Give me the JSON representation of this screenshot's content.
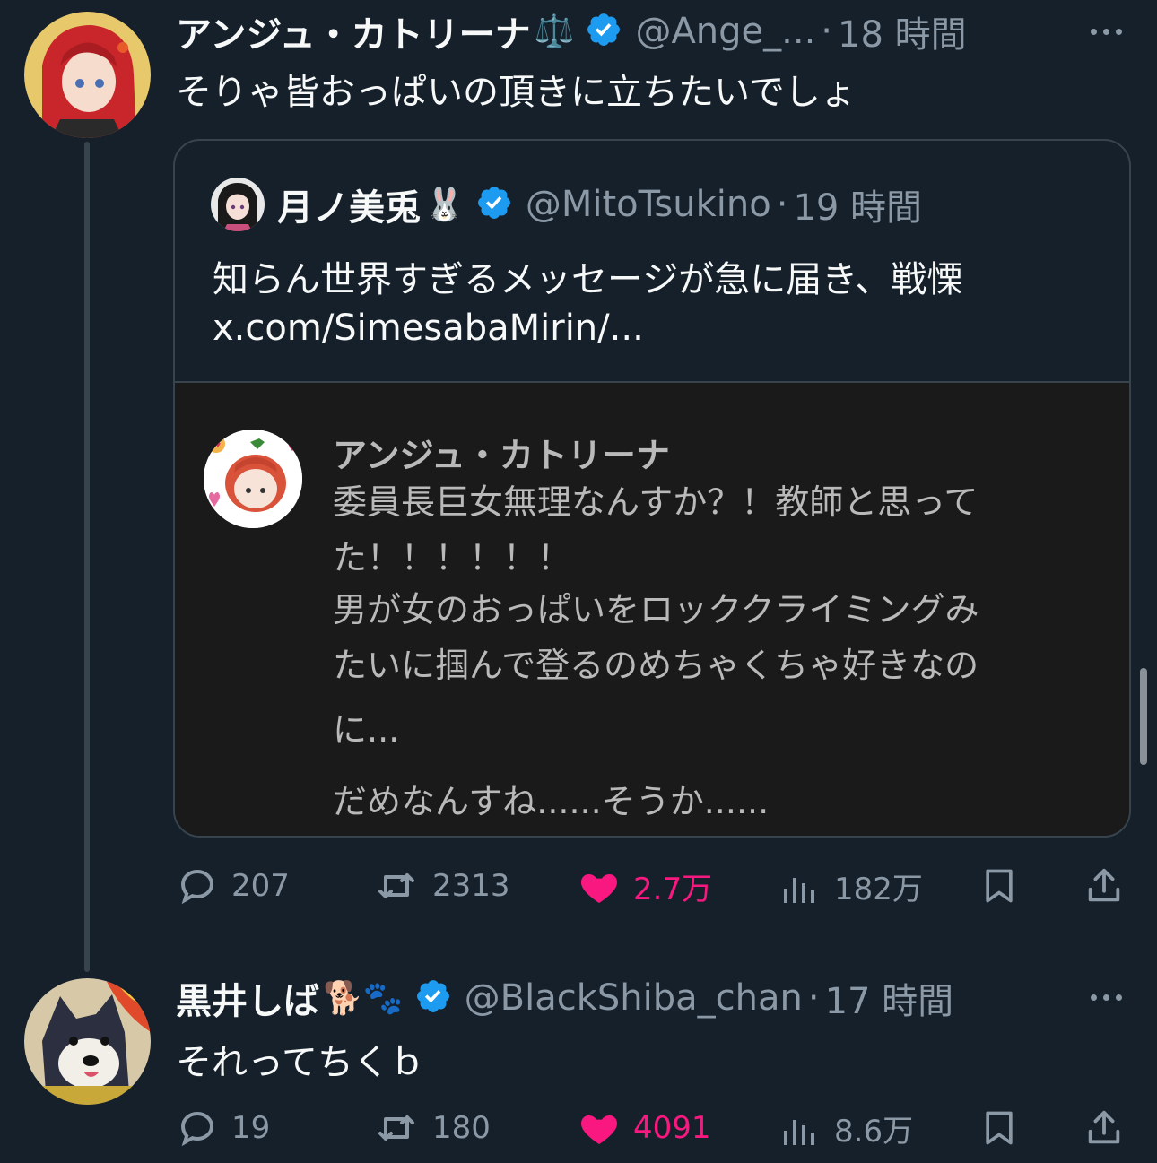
{
  "tweet1": {
    "display_name": "アンジュ・カトリーナ",
    "name_emoji": "⚖️",
    "handle": "@Ange_...",
    "time": "18 時間",
    "text": "そりゃ皆おっぱいの頂きに立ちたいでしょ",
    "quote": {
      "display_name": "月ノ美兎",
      "name_emoji": "🐰",
      "handle": "@MitoTsukino",
      "time": "19 時間",
      "text_line1": "知らん世界すぎるメッセージが急に届き、戦慄",
      "text_line2": "x.com/SimesabaMirin/...",
      "media": {
        "name": "アンジュ・カトリーナ",
        "lines": [
          "委員長巨女無理なんすか？！教師と思って",
          "た！！！！！！",
          "男が女のおっぱいをロッククライミングみ",
          "たいに掴んで登るのめちゃくちゃ好きなの",
          "に...",
          "だめなんすね......そうか......"
        ]
      }
    },
    "actions": {
      "replies": "207",
      "retweets": "2313",
      "likes": "2.7万",
      "views": "182万"
    }
  },
  "tweet2": {
    "display_name": "黒井しば",
    "name_emoji": "🐕🐾",
    "handle": "@BlackShiba_chan",
    "time": "17 時間",
    "text": "それってちくｂ",
    "actions": {
      "replies": "19",
      "retweets": "180",
      "likes": "4091",
      "views": "8.6万"
    }
  },
  "colors": {
    "background": "#15202b",
    "text": "#f7f9f9",
    "secondary": "#8b98a5",
    "like": "#f91880",
    "verified": "#1d9bf0"
  }
}
